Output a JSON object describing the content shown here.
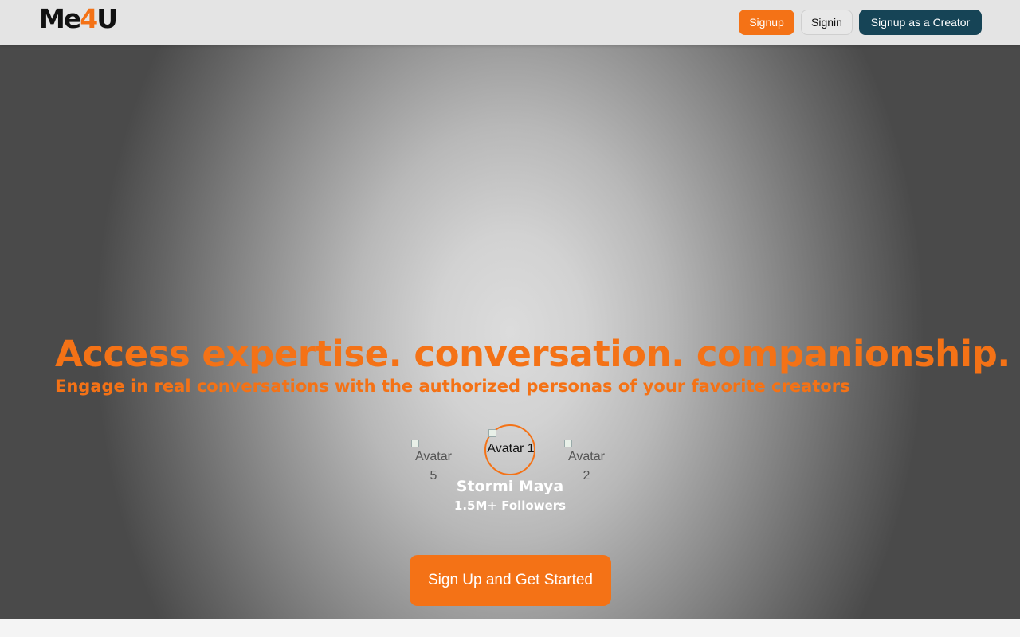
{
  "header": {
    "logo": {
      "part1": "Me",
      "part2": "4",
      "part3": "U"
    },
    "nav": {
      "signup_label": "Signup",
      "signin_label": "Signin",
      "creator_label": "Signup as a Creator"
    }
  },
  "hero": {
    "headline": "Access expertise. conversation. companionship.",
    "subheadline": "Engage in real conversations with the authorized personas of your favorite creators",
    "avatars": {
      "left": {
        "alt": "Avatar 5"
      },
      "center": {
        "alt": "Avatar 1"
      },
      "right": {
        "alt": "Avatar 2"
      }
    },
    "featured_creator": {
      "name": "Stormi Maya",
      "followers": "1.5M+ Followers"
    },
    "cta_label": "Sign Up and Get Started"
  },
  "colors": {
    "accent": "#f47216",
    "creator_button": "#164456",
    "header_bg": "#e4e4e4"
  }
}
